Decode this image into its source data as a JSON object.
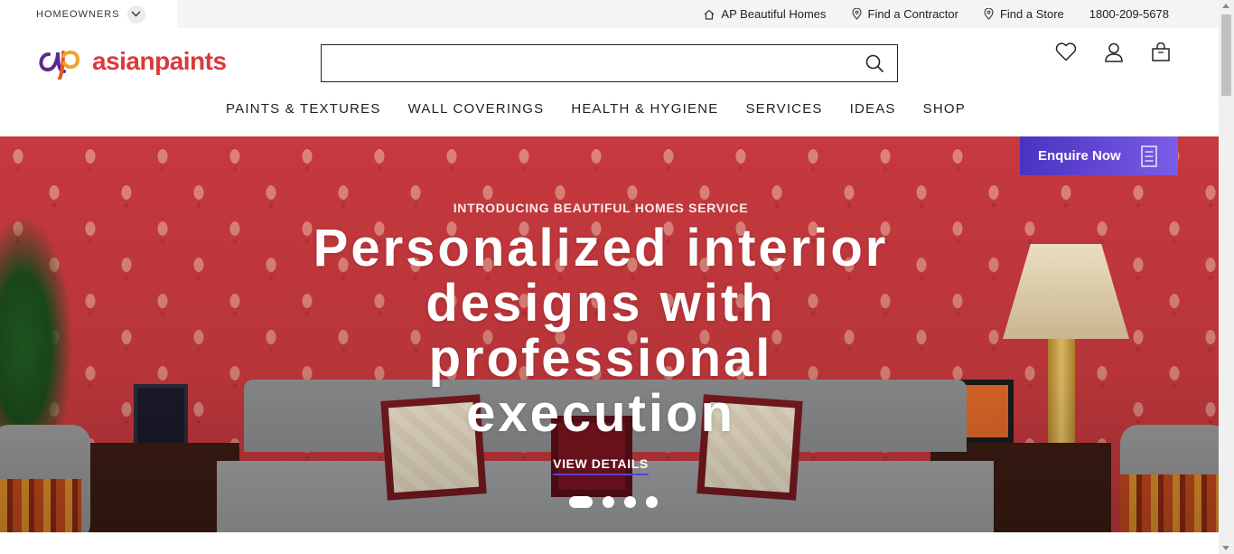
{
  "topbar": {
    "segment_label": "HOMEOWNERS",
    "links": [
      {
        "label": "AP Beautiful Homes",
        "icon": "house-icon"
      },
      {
        "label": "Find a Contractor",
        "icon": "location-pin-icon"
      },
      {
        "label": "Find a Store",
        "icon": "location-pin-icon"
      }
    ],
    "phone": "1800-209-5678"
  },
  "header": {
    "logo_text": "asianpaints",
    "search": {
      "value": "",
      "placeholder": ""
    },
    "icons": [
      "heart-icon",
      "user-icon",
      "shopping-bag-icon"
    ]
  },
  "nav": {
    "items": [
      "PAINTS & TEXTURES",
      "WALL COVERINGS",
      "HEALTH & HYGIENE",
      "SERVICES",
      "IDEAS",
      "SHOP"
    ]
  },
  "hero": {
    "kicker": "INTRODUCING BEAUTIFUL HOMES SERVICE",
    "title_lines": [
      "Personalized interior",
      "designs with",
      "professional",
      "execution"
    ],
    "cta": "VIEW DETAILS",
    "slides_total": 4,
    "active_slide": 1
  },
  "enquire": {
    "label": "Enquire Now",
    "icon": "form-icon"
  },
  "colors": {
    "brand_red": "#d93a3a",
    "enquire_gradient": [
      "#4a32c0",
      "#7a5de6"
    ],
    "cta_underline": "#5b3fd6"
  }
}
